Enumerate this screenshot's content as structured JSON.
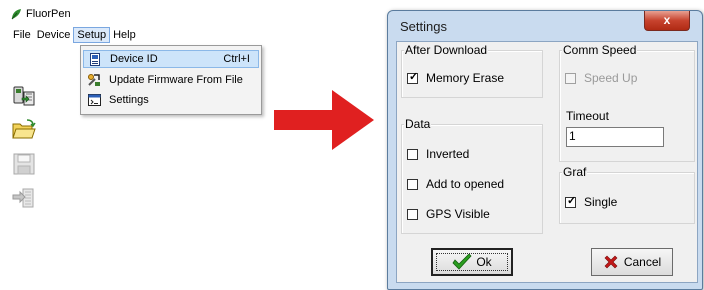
{
  "app": {
    "title": "FluorPen"
  },
  "menubar": {
    "file": "File",
    "device": "Device",
    "setup": "Setup",
    "help": "Help"
  },
  "setup_menu": [
    {
      "label": "Device ID",
      "shortcut": "Ctrl+I",
      "icon": "device-id-icon",
      "highlighted": true
    },
    {
      "label": "Update Firmware From File",
      "shortcut": "",
      "icon": "firmware-update-icon",
      "highlighted": false
    },
    {
      "label": "Settings",
      "shortcut": "",
      "icon": "settings-icon",
      "highlighted": false
    }
  ],
  "toolbar": [
    "download-icon",
    "open-folder-icon",
    "save-icon",
    "export-icon"
  ],
  "colors": {
    "arrow": "#e02020",
    "dialog_frame": "#c9dbef",
    "close_button": "#c7432e",
    "ok_check": "#2a9d1f",
    "cancel_x": "#c21818"
  },
  "dialog": {
    "title": "Settings",
    "close_label": "x",
    "after_download": {
      "legend": "After Download",
      "memory_erase": {
        "label": "Memory Erase",
        "checked": true
      }
    },
    "data": {
      "legend": "Data",
      "inverted": {
        "label": "Inverted",
        "checked": false
      },
      "add_to_opened": {
        "label": "Add to opened",
        "checked": false
      },
      "gps_visible": {
        "label": "GPS Visible",
        "checked": false
      }
    },
    "comm_speed": {
      "legend": "Comm Speed",
      "speed_up": {
        "label": "Speed Up",
        "checked": false,
        "disabled": true
      },
      "timeout_label": "Timeout",
      "timeout_value": "1"
    },
    "graf": {
      "legend": "Graf",
      "single": {
        "label": "Single",
        "checked": true
      }
    },
    "ok_label": "Ok",
    "cancel_label": "Cancel"
  }
}
